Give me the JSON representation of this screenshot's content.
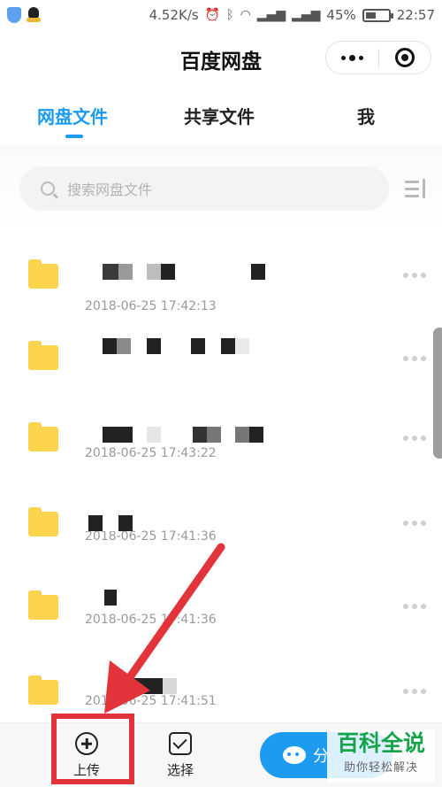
{
  "status_bar": {
    "speed": "4.52K/s",
    "battery_percent": "45%",
    "battery_level": 0.45,
    "time": "22:57",
    "icons": [
      "shield-icon",
      "qq-penguin-icon",
      "alarm-icon",
      "bluetooth-icon",
      "wifi-icon",
      "signal-icon",
      "signal-icon",
      "battery-icon"
    ]
  },
  "header": {
    "title": "百度网盘",
    "capsule_icons": [
      "more-dots-icon",
      "target-close-icon"
    ]
  },
  "tabs": [
    {
      "label": "网盘文件",
      "active": true
    },
    {
      "label": "共享文件",
      "active": false
    },
    {
      "label": "我",
      "active": false
    }
  ],
  "search": {
    "placeholder": "搜索网盘文件",
    "sort_icon": "sort-icon"
  },
  "files": [
    {
      "date": "2018-06-25 17:42:13",
      "icon": "folder-icon"
    },
    {
      "date": "",
      "icon": "folder-icon"
    },
    {
      "date": "2018-06-25 17:43:22",
      "icon": "folder-icon"
    },
    {
      "date": "2018-06-25 17:41:36",
      "icon": "folder-icon"
    },
    {
      "date": "2018-06-25 17:41:36",
      "icon": "folder-icon"
    },
    {
      "date": "2018-06-25 17:41:51",
      "icon": "folder-icon"
    }
  ],
  "bottom_bar": {
    "upload_label": "上传",
    "select_label": "选择",
    "share_label": "分"
  },
  "watermark": {
    "title": "百科全说",
    "subtitle": "助你轻松解决"
  },
  "colors": {
    "accent": "#1c9bf0",
    "folder": "#fcd34d",
    "annotation": "#e2343a",
    "watermark": "#16a34a"
  }
}
